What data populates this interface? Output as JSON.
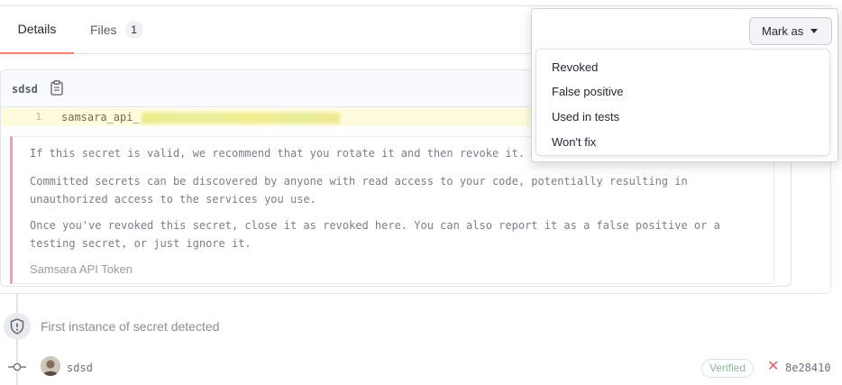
{
  "tabs": [
    {
      "label": "Details"
    },
    {
      "label": "Files",
      "count": "1"
    }
  ],
  "file": {
    "name": "sdsd",
    "line_number": "1",
    "code_prefix": "samsara_api_"
  },
  "alert": {
    "paragraphs": [
      "If this secret is valid, we recommend that you rotate it and then revoke it.",
      "Committed secrets can be discovered by anyone with read access to your code, potentially resulting in unauthorized access to the services you use.",
      "Once you've revoked this secret, close it as revoked here. You can also report it as a false positive or a testing secret, or just ignore it."
    ],
    "secret_type": "Samsara API Token"
  },
  "timeline": {
    "event": "First instance of secret detected",
    "commit": {
      "author": "sdsd",
      "verified": "Verified",
      "sha": "8e28410"
    }
  },
  "mark_as": {
    "button_label": "Mark as",
    "options": [
      "Revoked",
      "False positive",
      "Used in tests",
      "Won't fix"
    ]
  },
  "colors": {
    "accent_tab_underline": "#f9826c",
    "highlight_line": "#fffbdd",
    "alert_border": "#e9a0a6",
    "verified_text": "#8cb59a",
    "error_mark": "#d9606a"
  },
  "icons": [
    "clipboard-icon",
    "shield-icon",
    "git-commit-icon",
    "x-icon",
    "caret-down-icon"
  ]
}
